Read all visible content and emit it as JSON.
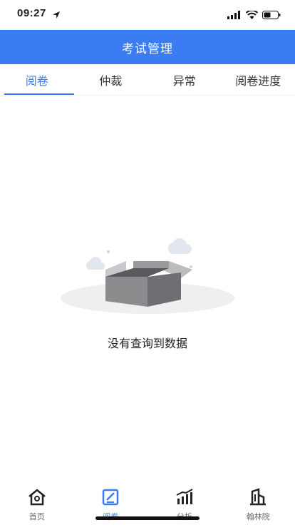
{
  "status_bar": {
    "time": "09:27"
  },
  "header": {
    "title": "考试管理"
  },
  "tabs": [
    {
      "label": "阅卷",
      "active": true
    },
    {
      "label": "仲裁",
      "active": false
    },
    {
      "label": "异常",
      "active": false
    },
    {
      "label": "阅卷进度",
      "active": false
    }
  ],
  "empty_state": {
    "message": "没有查询到数据"
  },
  "bottom_nav": [
    {
      "label": "首页",
      "icon": "home-icon",
      "active": false
    },
    {
      "label": "阅卷",
      "icon": "edit-icon",
      "active": true
    },
    {
      "label": "分析",
      "icon": "chart-icon",
      "active": false
    },
    {
      "label": "翰林院",
      "icon": "building-icon",
      "active": false
    }
  ],
  "colors": {
    "primary": "#3b7cf2",
    "text": "#222222"
  }
}
